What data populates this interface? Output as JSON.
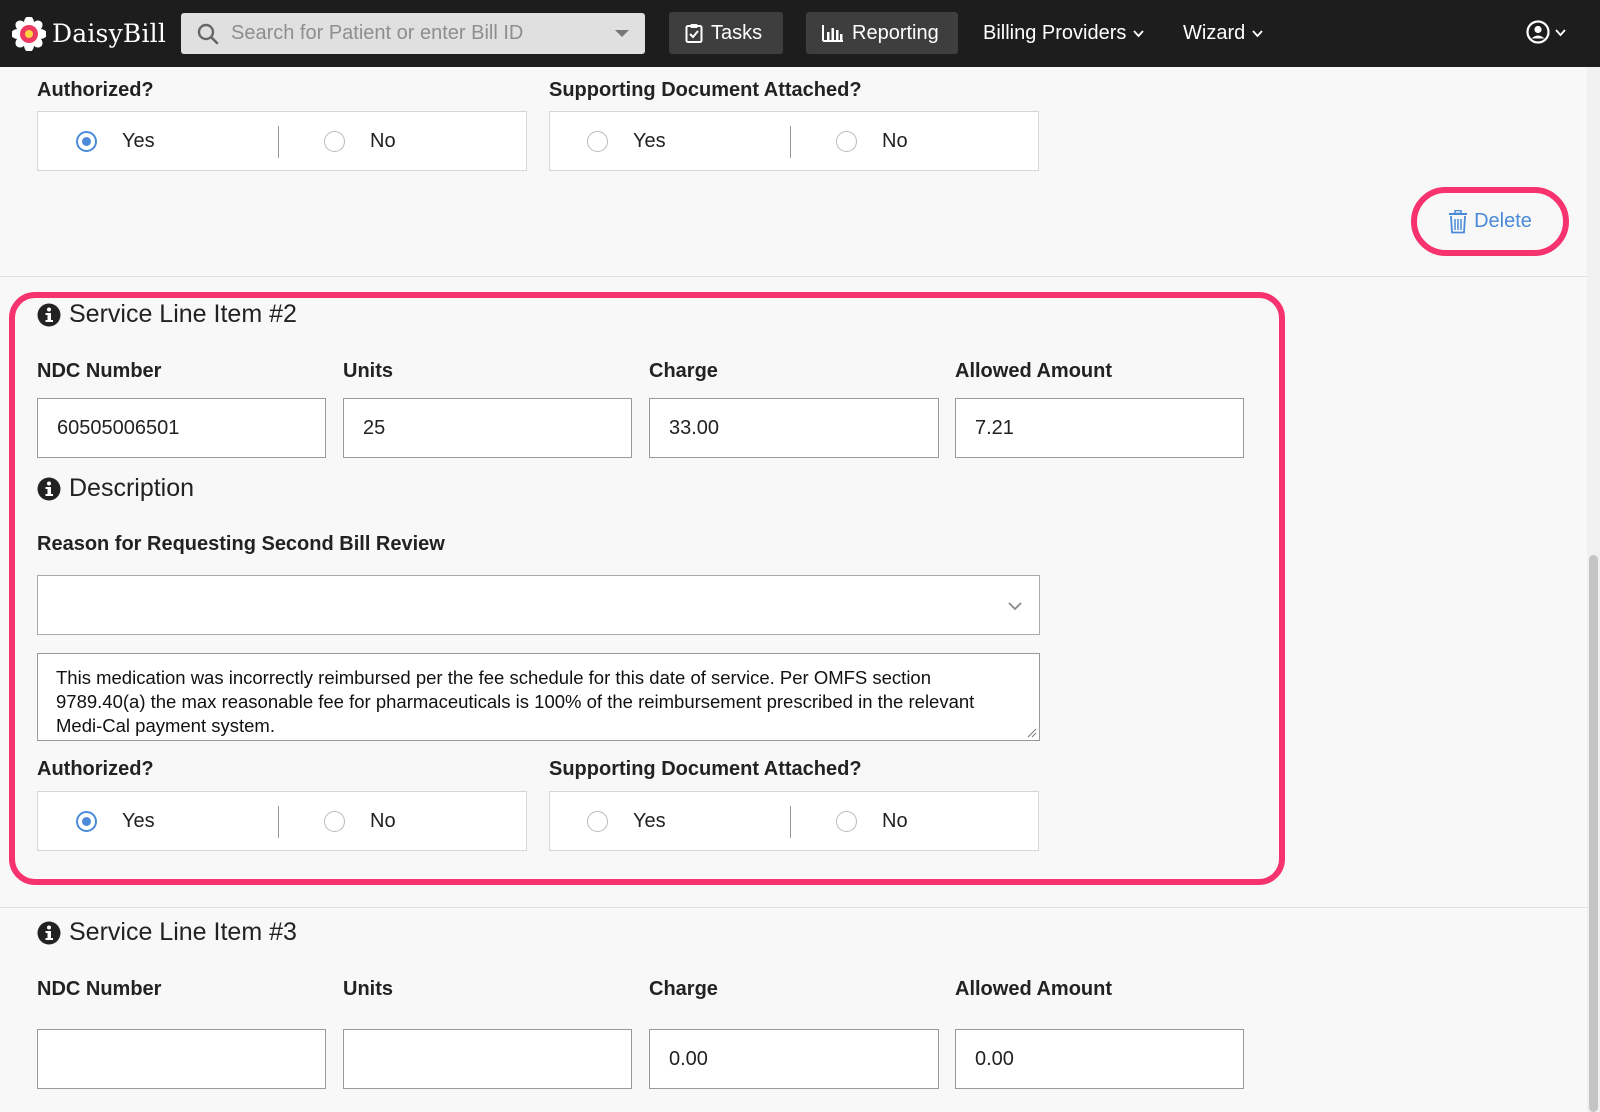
{
  "navbar": {
    "brand": "DaisyBill",
    "search_placeholder": "Search for Patient or enter Bill ID",
    "tasks_label": "Tasks",
    "reporting_label": "Reporting",
    "billing_providers_label": "Billing Providers",
    "wizard_label": "Wizard"
  },
  "line1_tail": {
    "authorized_label": "Authorized?",
    "authorized_options": [
      "Yes",
      "No"
    ],
    "authorized_selected": "Yes",
    "supporting_label": "Supporting Document Attached?",
    "supporting_options": [
      "Yes",
      "No"
    ],
    "delete_label": "Delete"
  },
  "line2": {
    "title": "Service Line Item #2",
    "ndc_label": "NDC Number",
    "ndc_value": "60505006501",
    "units_label": "Units",
    "units_value": "25",
    "charge_label": "Charge",
    "charge_value": "33.00",
    "allowed_label": "Allowed Amount",
    "allowed_value": "7.21",
    "description_title": "Description",
    "reason_label": "Reason for Requesting Second Bill Review",
    "reason_value": "",
    "description_text": "This medication was incorrectly reimbursed per the fee schedule for this date of service. Per OMFS section 9789.40(a) the max reasonable fee for pharmaceuticals is 100% of the reimbursement prescribed in the relevant Medi-Cal payment system.",
    "authorized_label": "Authorized?",
    "authorized_options": [
      "Yes",
      "No"
    ],
    "authorized_selected": "Yes",
    "supporting_label": "Supporting Document Attached?",
    "supporting_options": [
      "Yes",
      "No"
    ]
  },
  "line3": {
    "title": "Service Line Item #3",
    "ndc_label": "NDC Number",
    "ndc_value": "",
    "units_label": "Units",
    "units_value": "",
    "charge_label": "Charge",
    "charge_value": "0.00",
    "allowed_label": "Allowed Amount",
    "allowed_value": "0.00"
  },
  "colors": {
    "highlight": "#f6336e",
    "accent": "#4a8ad9",
    "navbar_bg": "#1d1d1d"
  }
}
